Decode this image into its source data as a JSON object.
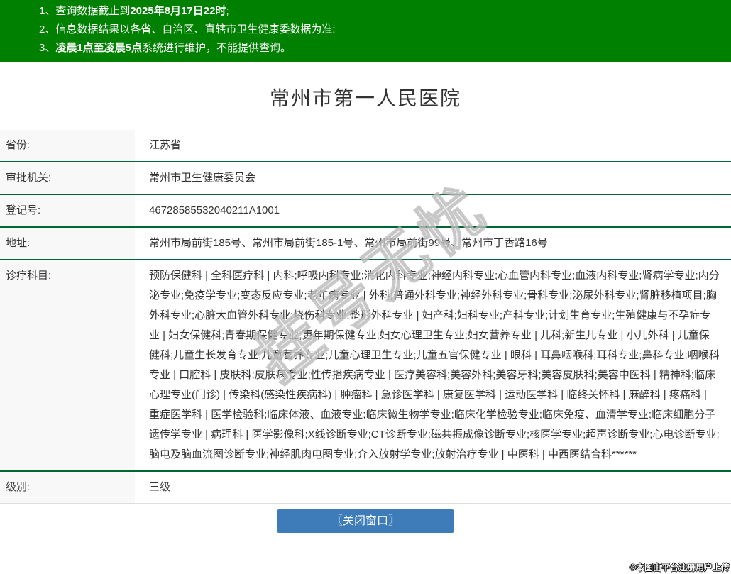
{
  "notices": {
    "line1": {
      "prefix": "1、查询数据截止到",
      "bold": "2025年8月17日22时",
      "suffix": ";"
    },
    "line2": {
      "text": "2、信息数据结果以各省、自治区、直辖市卫生健康委数据为准;"
    },
    "line3": {
      "prefix": "3、",
      "bold": "凌晨1点至凌晨5点",
      "suffix": "系统进行维护，不能提供查询。"
    }
  },
  "title": "常州市第一人民医院",
  "fields": [
    {
      "label": "省份:",
      "value": "江苏省"
    },
    {
      "label": "审批机关:",
      "value": "常州市卫生健康委员会"
    },
    {
      "label": "登记号:",
      "value": "46728585532040211A1001"
    },
    {
      "label": "地址:",
      "value": "常州市局前街185号、常州市局前街185-1号、常州市局前街99号、常州市丁香路16号"
    },
    {
      "label": "诊疗科目:",
      "value": "预防保健科 | 全科医疗科 | 内科;呼吸内科专业;消化内科专业;神经内科专业;心血管内科专业;血液内科专业;肾病学专业;内分泌专业;免疫学专业;变态反应专业;老年病专业 | 外科;普通外科专业;神经外科专业;骨科专业;泌尿外科专业;肾脏移植项目;胸外科专业;心脏大血管外科专业;烧伤科专业;整形外科专业 | 妇产科;妇科专业;产科专业;计划生育专业;生殖健康与不孕症专业 | 妇女保健科;青春期保健专业;更年期保健专业;妇女心理卫生专业;妇女营养专业 | 儿科;新生儿专业 | 小儿外科 | 儿童保健科;儿童生长发育专业;儿童营养专业;儿童心理卫生专业;儿童五官保健专业 | 眼科 | 耳鼻咽喉科;耳科专业;鼻科专业;咽喉科专业 | 口腔科 | 皮肤科;皮肤病专业;性传播疾病专业 | 医疗美容科;美容外科;美容牙科;美容皮肤科;美容中医科 | 精神科;临床心理专业(门诊) | 传染科(感染性疾病科) | 肿瘤科 | 急诊医学科 | 康复医学科 | 运动医学科 | 临终关怀科 | 麻醉科 | 疼痛科 | 重症医学科 | 医学检验科;临床体液、血液专业;临床微生物学专业;临床化学检验专业;临床免疫、血清学专业;临床细胞分子遗传学专业 | 病理科 | 医学影像科;X线诊断专业;CT诊断专业;磁共振成像诊断专业;核医学专业;超声诊断专业;心电诊断专业;脑电及脑血流图诊断专业;神经肌肉电图专业;介入放射学专业;放射治疗专业 | 中医科 | 中西医结合科******"
    },
    {
      "label": "级别:",
      "value": "三级"
    }
  ],
  "close_button_label": "〖关闭窗口〗",
  "watermarks": {
    "center": "挂号无忧",
    "corner": "©本图由平台注册用户上传"
  },
  "colors": {
    "header_green": "#008000",
    "row_divider_green": "#006633",
    "button_blue": "#3d7cb8",
    "label_bg": "#f8f8f8",
    "text": "#333333"
  }
}
